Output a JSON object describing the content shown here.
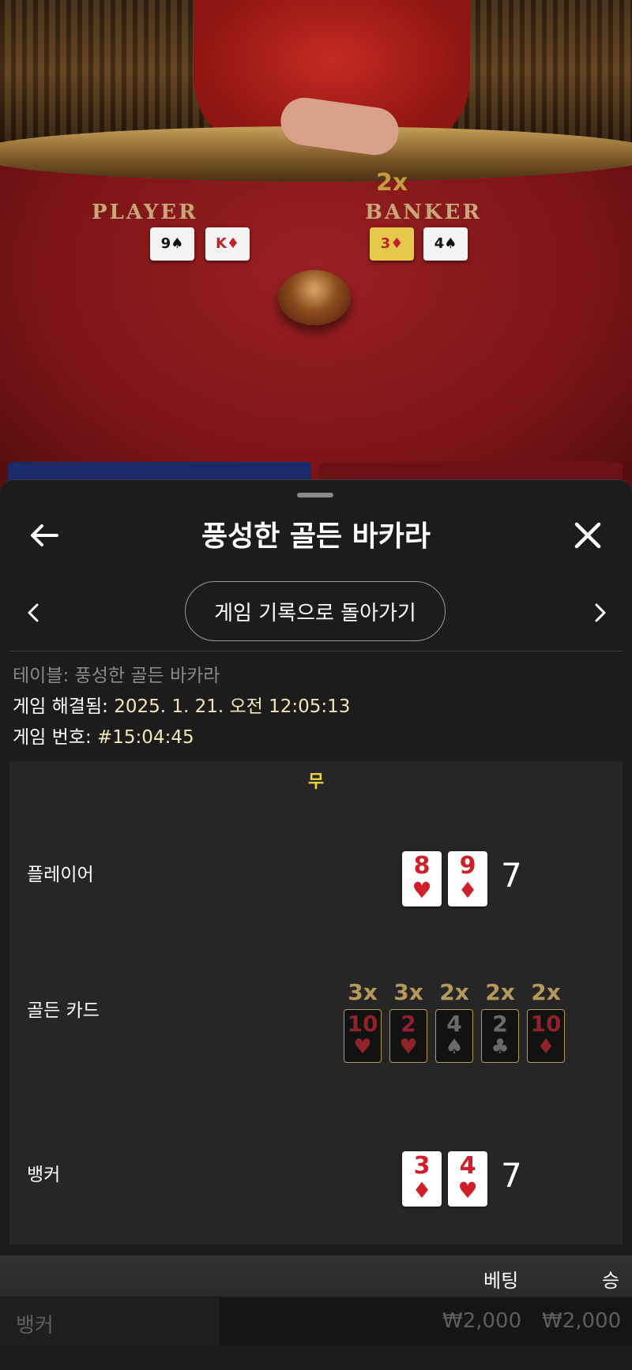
{
  "video": {
    "player_label": "PLAYER",
    "banker_label": "BANKER",
    "banker_multiplier": "2x",
    "player_cards": [
      {
        "rank": "9",
        "suit": "♠",
        "red": false
      },
      {
        "rank": "K",
        "suit": "♦",
        "red": true
      }
    ],
    "banker_cards": [
      {
        "rank": "3",
        "suit": "♦",
        "red": true,
        "gold": true
      },
      {
        "rank": "4",
        "suit": "♠",
        "red": false
      }
    ]
  },
  "sheet": {
    "title": "풍성한 골든 바카라",
    "back_to_history": "게임 기록으로 돌아가기",
    "table_label": "테이블:",
    "table_value": "풍성한 골든 바카라",
    "resolved_label": "게임 해결됨:",
    "resolved_value": "2025. 1. 21. 오전 12:05:13",
    "game_no_label": "게임 번호:",
    "game_no_value": "#15:04:45"
  },
  "result": {
    "outcome": "무",
    "player_label": "플레이어",
    "player_cards": [
      {
        "rank": "8",
        "suit": "♥"
      },
      {
        "rank": "9",
        "suit": "♦"
      }
    ],
    "player_score": "7",
    "golden_label": "골든 카드",
    "golden_cards": [
      {
        "mult": "3x",
        "rank": "10",
        "suit": "♥",
        "red": true
      },
      {
        "mult": "3x",
        "rank": "2",
        "suit": "♥",
        "red": true
      },
      {
        "mult": "2x",
        "rank": "4",
        "suit": "♠",
        "red": false
      },
      {
        "mult": "2x",
        "rank": "2",
        "suit": "♣",
        "red": false
      },
      {
        "mult": "2x",
        "rank": "10",
        "suit": "♦",
        "red": true
      }
    ],
    "banker_label": "뱅커",
    "banker_cards": [
      {
        "rank": "3",
        "suit": "♦"
      },
      {
        "rank": "4",
        "suit": "♥"
      }
    ],
    "banker_score": "7"
  },
  "bets": {
    "header_bet": "베팅",
    "header_win": "승",
    "rows": [
      {
        "name": "뱅커",
        "bet": "₩2,000",
        "win": "₩2,000"
      }
    ]
  },
  "colors": {
    "accent_gold": "#b39a5c",
    "outcome_yellow": "#f2d43c",
    "card_red": "#d01f2a"
  }
}
